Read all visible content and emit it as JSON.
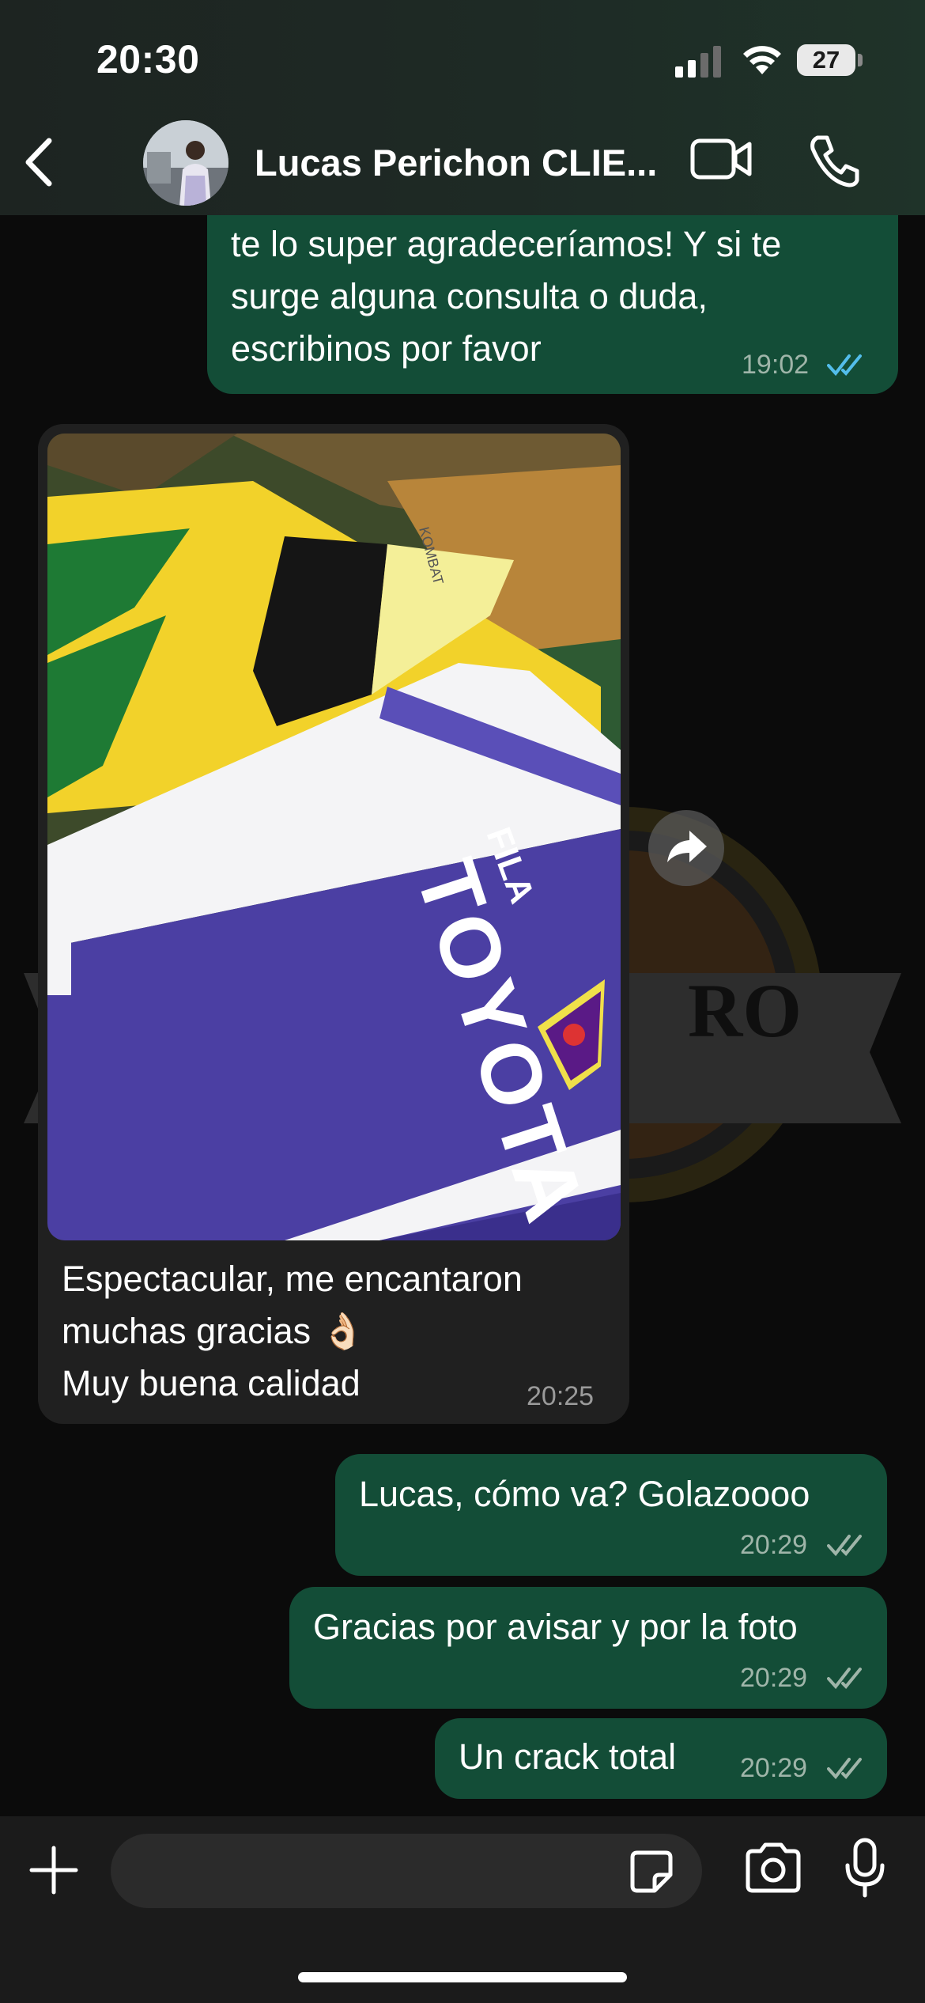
{
  "status_bar": {
    "time": "20:30",
    "battery": "27"
  },
  "header": {
    "contact_name": "Lucas Perichon CLIE..."
  },
  "messages": [
    {
      "direction": "out",
      "text": "te lo super agradeceríamos! Y si te\nsurge alguna consulta o duda,\nescribinos por favor",
      "time": "19:02",
      "status": "read"
    },
    {
      "direction": "in",
      "has_photo": true,
      "photo_text": [
        "FILA",
        "TOYOTA",
        "KOMBAT"
      ],
      "text": "Espectacular, me encantaron\nmuchas gracias 👌🏻\nMuy buena calidad",
      "time": "20:25"
    },
    {
      "direction": "out",
      "text": "Lucas, cómo va? Golazoooo",
      "time": "20:29",
      "status": "delivered"
    },
    {
      "direction": "out",
      "text": "Gracias por avisar y por la foto",
      "time": "20:29",
      "status": "delivered"
    },
    {
      "direction": "out",
      "text": "Un crack total",
      "time": "20:29",
      "status": "delivered"
    }
  ],
  "wallpaper_text": "RO",
  "composer": {
    "placeholder": ""
  },
  "colors": {
    "outgoing_bubble": "#134d37",
    "incoming_bubble": "#202020",
    "read_tick": "#53bdeb",
    "delivered_tick": "#9fb5a9",
    "header": "#1e2a25"
  },
  "icons": [
    "back-arrow-icon",
    "video-call-icon",
    "phone-icon",
    "forward-icon",
    "plus-icon",
    "sticker-icon",
    "camera-icon",
    "mic-icon",
    "signal-icon",
    "wifi-icon"
  ]
}
